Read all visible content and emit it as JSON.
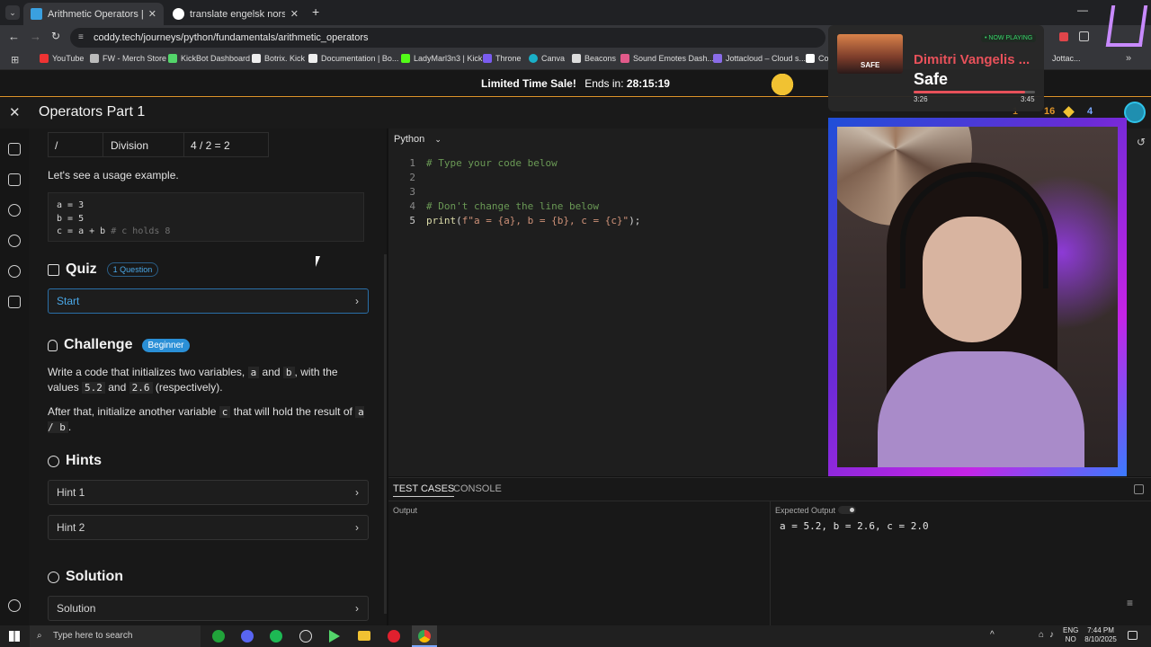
{
  "browser": {
    "tabs": [
      {
        "title": "Arithmetic Operators | Python",
        "active": true
      },
      {
        "title": "translate engelsk norsk - Googl",
        "active": false
      }
    ],
    "url": "coddy.tech/journeys/python/fundamentals/arithmetic_operators",
    "bookmarks": [
      "YouTube",
      "FW - Merch Store",
      "KickBot Dashboard",
      "Botrix. Kick",
      "Documentation | Bo...",
      "LadyMarl3n3 | Kick",
      "Throne",
      "Canva",
      "Beacons",
      "Sound Emotes Dash...",
      "Jottacloud – Cloud s...",
      "Co",
      "Jottac..."
    ]
  },
  "promo": {
    "text": "Limited Time Sale!",
    "ends_label": "Ends in:",
    "countdown": "28:15:19"
  },
  "header": {
    "title": "Operators Part 1",
    "stat1": "1",
    "gems": "16",
    "energy": "4"
  },
  "lesson": {
    "table_row": {
      "op": "/",
      "name": "Division",
      "example": "4 / 2 = 2"
    },
    "usage_intro": "Let's see a usage example.",
    "code_lines": [
      "a = 3",
      "b = 5",
      "c = a + b"
    ],
    "code_comment": "# c holds 8",
    "quiz": {
      "title": "Quiz",
      "badge": "1 Question",
      "start": "Start"
    },
    "challenge": {
      "title": "Challenge",
      "badge": "Beginner",
      "p1_a": "Write a code that initializes two variables,",
      "var_a": "a",
      "and": "and",
      "var_b": "b",
      "p1_b": ", with the values",
      "val1": "5.2",
      "and2": "and",
      "val2": "2.6",
      "p1_c": "(respectively).",
      "p2_a": "After that, initialize another variable",
      "var_c": "c",
      "p2_b": "that will hold the result of",
      "expr": "a / b",
      "p2_c": "."
    },
    "hints": {
      "title": "Hints",
      "items": [
        "Hint 1",
        "Hint 2"
      ]
    },
    "solution": {
      "title": "Solution",
      "item": "Solution"
    }
  },
  "editor": {
    "language": "Python",
    "line_numbers": [
      "1",
      "2",
      "3",
      "4",
      "5"
    ],
    "line1": "# Type your code below",
    "line4": "# Don't change the line below",
    "line5_fn": "print",
    "line5_open": "(",
    "line5_str": "f\"a = {a}, b = {b}, c = {c}\"",
    "line5_close": ");"
  },
  "panel": {
    "tabs": [
      "TEST CASES",
      "CONSOLE"
    ],
    "output_label": "Output",
    "expected_label": "Expected Output",
    "expected_value": "a = 5.2, b = 2.6, c = 2.0"
  },
  "now_playing": {
    "badge": "• NOW PLAYING",
    "artist": "Dimitri Vangelis ...",
    "track": "Safe",
    "elapsed": "3:26",
    "total": "3:45",
    "art_text": "SAFE",
    "progress": 0.92
  },
  "taskbar": {
    "search": "Type here to search",
    "lang1": "ENG",
    "lang2": "NO",
    "time": "7:44 PM",
    "date": "8/10/2025"
  },
  "colors": {
    "accent": "#e0952a",
    "badge_blue": "#2a8fd6",
    "now_playing_green": "#3ad46b",
    "artist_red": "#e8515a"
  }
}
